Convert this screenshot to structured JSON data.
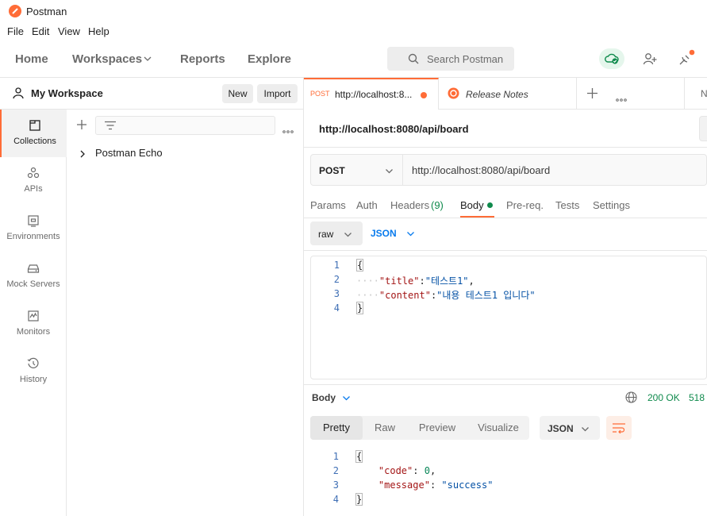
{
  "app": {
    "title": "Postman"
  },
  "menu": [
    "File",
    "Edit",
    "View",
    "Help"
  ],
  "nav": {
    "home": "Home",
    "workspaces": "Workspaces",
    "reports": "Reports",
    "explore": "Explore",
    "search_placeholder": "Search Postman"
  },
  "workspace": {
    "title": "My Workspace",
    "new_label": "New",
    "import_label": "Import"
  },
  "rail": [
    "Collections",
    "APIs",
    "Environments",
    "Mock Servers",
    "Monitors",
    "History"
  ],
  "collections": [
    {
      "name": "Postman Echo"
    }
  ],
  "tabs": [
    {
      "method": "POST",
      "title": "http://localhost:8..."
    },
    {
      "title": "Release Notes"
    },
    {
      "title": "N"
    }
  ],
  "request": {
    "title": "http://localhost:8080/api/board",
    "method": "POST",
    "url": "http://localhost:8080/api/board",
    "subtabs": {
      "params": "Params",
      "auth": "Auth",
      "headers": "Headers",
      "headers_count": "(9)",
      "body": "Body",
      "prereq": "Pre-req.",
      "tests": "Tests",
      "settings": "Settings"
    },
    "body_mode": "raw",
    "body_lang": "JSON",
    "body_lines": {
      "l1": "{",
      "l2_key": "\"title\"",
      "l2_val": "\"테스트1\"",
      "l3_key": "\"content\"",
      "l3_val": "\"내용 테스트1 입니다\"",
      "l4": "}"
    }
  },
  "response": {
    "label": "Body",
    "status": "200 OK",
    "size": "518",
    "tabs": [
      "Pretty",
      "Raw",
      "Preview",
      "Visualize"
    ],
    "lang": "JSON",
    "lines": {
      "l1": "{",
      "code_key": "\"code\"",
      "code_val": "0",
      "msg_key": "\"message\"",
      "msg_val": "\"success\"",
      "l4": "}"
    }
  },
  "colors": {
    "accent": "#ff6c37",
    "success": "#0f8a4c",
    "link": "#097bed"
  }
}
